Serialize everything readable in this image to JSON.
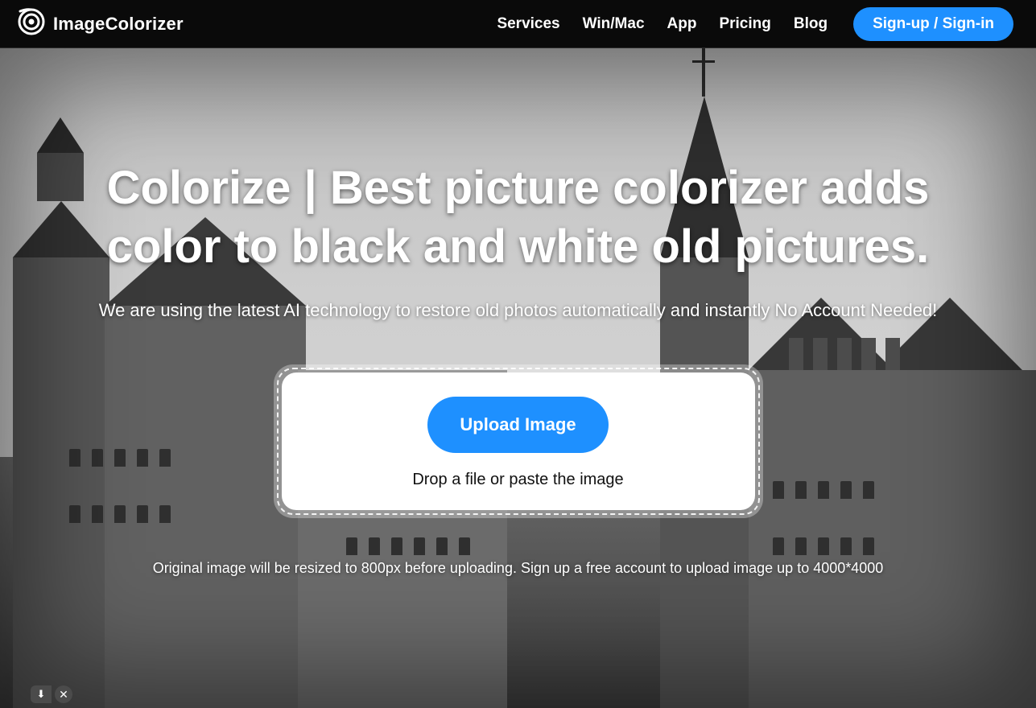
{
  "header": {
    "brand": "ImageColorizer",
    "nav": {
      "services": "Services",
      "winmac": "Win/Mac",
      "app": "App",
      "pricing": "Pricing",
      "blog": "Blog"
    },
    "signup": "Sign-up / Sign-in"
  },
  "hero": {
    "title": "Colorize | Best picture colorizer adds color to black and white old pictures.",
    "subtitle": "We are using the latest AI technology to restore old photos automatically and instantly No Account Needed!",
    "upload_button": "Upload Image",
    "upload_hint": "Drop a file or paste the image",
    "resize_note": "Original image will be resized to 800px before uploading. Sign up a free account to upload image up to 4000*4000"
  },
  "pill": {
    "download": "⬇",
    "close": "✕"
  }
}
